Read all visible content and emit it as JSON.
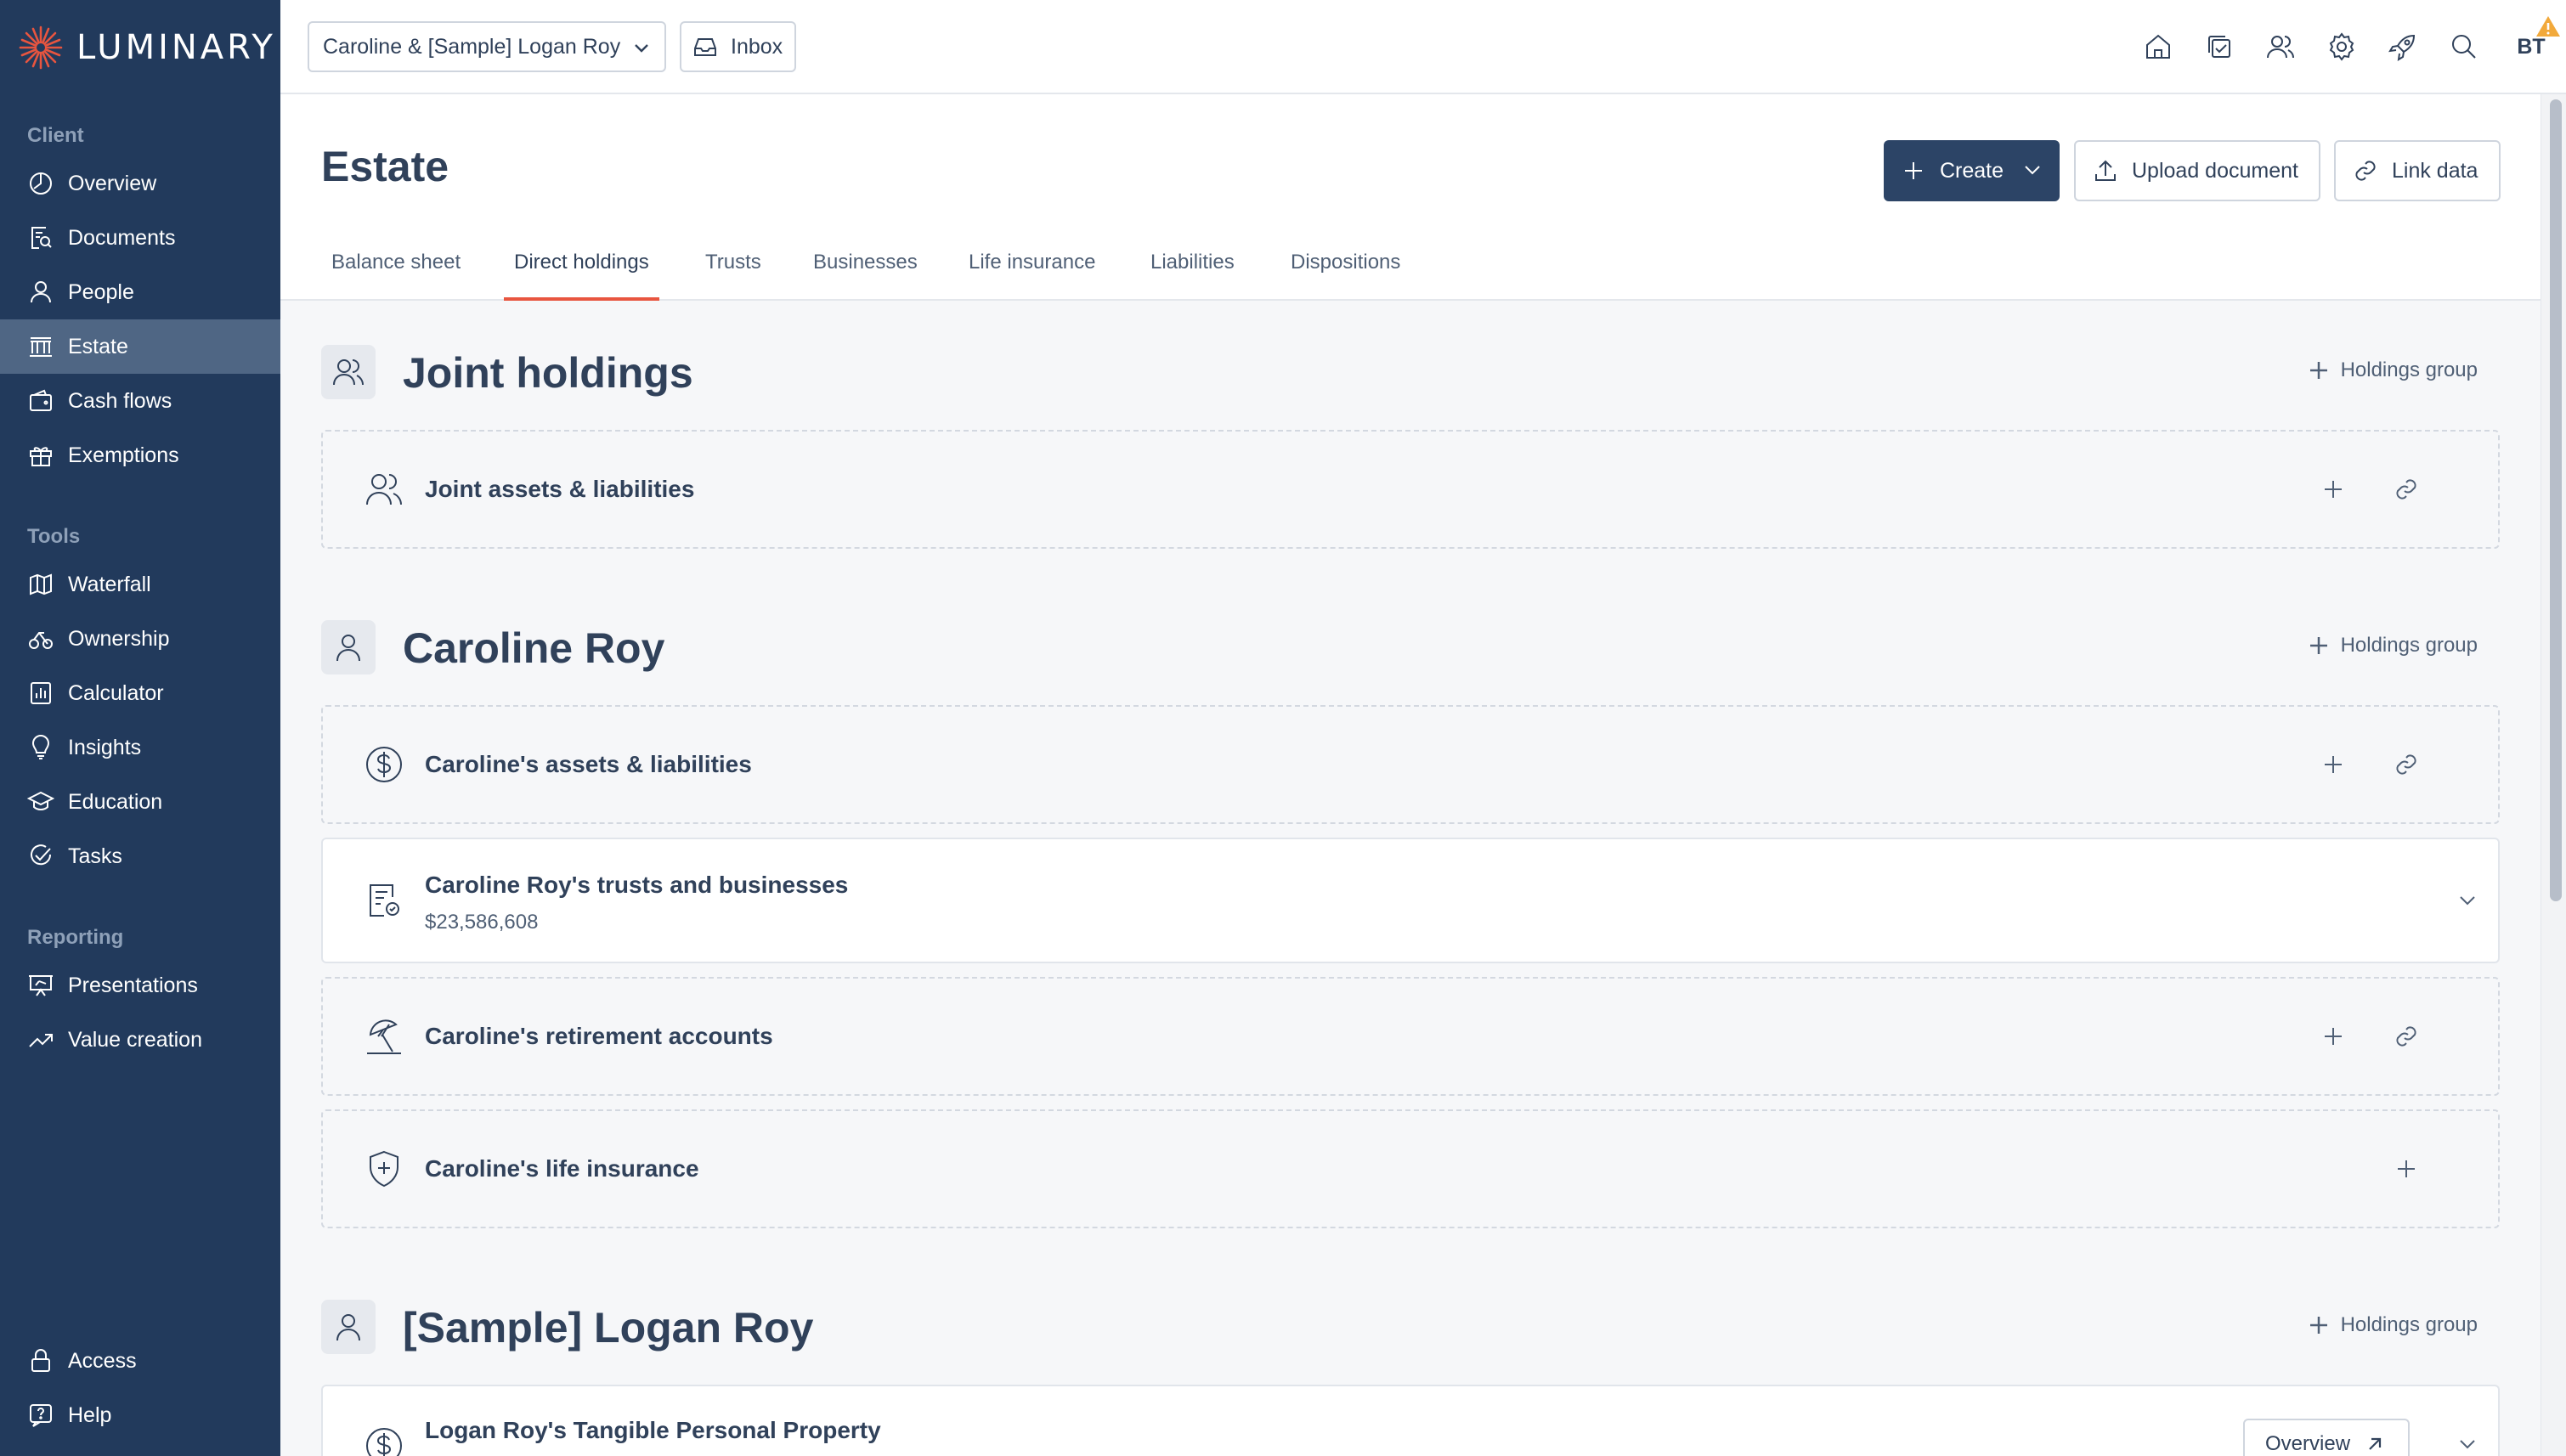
{
  "app": {
    "brand": "LUMINARY",
    "accent": "#e8553f",
    "sidebar_color": "#223a5c"
  },
  "sidebar": {
    "sections": {
      "client": "Client",
      "tools": "Tools",
      "reporting": "Reporting"
    },
    "client_items": [
      {
        "label": "Overview",
        "icon": "compass-icon"
      },
      {
        "label": "Documents",
        "icon": "document-search-icon"
      },
      {
        "label": "People",
        "icon": "person-icon"
      },
      {
        "label": "Estate",
        "icon": "bank-icon",
        "active": true
      },
      {
        "label": "Cash flows",
        "icon": "wallet-icon"
      },
      {
        "label": "Exemptions",
        "icon": "gift-icon"
      }
    ],
    "tools_items": [
      {
        "label": "Waterfall",
        "icon": "map-icon"
      },
      {
        "label": "Ownership",
        "icon": "ownership-icon"
      },
      {
        "label": "Calculator",
        "icon": "calculator-icon"
      },
      {
        "label": "Insights",
        "icon": "lightbulb-icon"
      },
      {
        "label": "Education",
        "icon": "graduation-cap-icon"
      },
      {
        "label": "Tasks",
        "icon": "check-circle-icon"
      }
    ],
    "reporting_items": [
      {
        "label": "Presentations",
        "icon": "presentation-icon"
      },
      {
        "label": "Value creation",
        "icon": "trend-up-icon"
      }
    ],
    "footer_items": [
      {
        "label": "Access",
        "icon": "lock-icon"
      },
      {
        "label": "Help",
        "icon": "help-icon"
      }
    ]
  },
  "topbar": {
    "client_selector": "Caroline & [Sample] Logan Roy",
    "inbox_label": "Inbox",
    "user_initials": "BT",
    "icons": [
      "home-icon",
      "tasks-icon",
      "people-icon",
      "settings-icon",
      "rocket-icon",
      "search-icon"
    ]
  },
  "page": {
    "title": "Estate",
    "create_label": "Create",
    "upload_label": "Upload document",
    "link_label": "Link data",
    "tabs": [
      "Balance sheet",
      "Direct holdings",
      "Trusts",
      "Businesses",
      "Life insurance",
      "Liabilities",
      "Dispositions"
    ],
    "active_tab": "Direct holdings"
  },
  "content": {
    "add_group_label": "Holdings group",
    "overview_label": "Overview",
    "sections": [
      {
        "title": "Joint holdings",
        "cards": [
          {
            "title": "Joint assets & liabilities"
          }
        ]
      },
      {
        "title": "Caroline Roy",
        "cards": [
          {
            "title": "Caroline's assets & liabilities"
          },
          {
            "title": "Caroline Roy's trusts and businesses",
            "value": "$23,586,608"
          },
          {
            "title": "Caroline's retirement accounts"
          },
          {
            "title": "Caroline's life insurance"
          }
        ]
      },
      {
        "title": "[Sample] Logan Roy",
        "cards": [
          {
            "title": "Logan Roy's Tangible Personal Property"
          }
        ]
      }
    ]
  }
}
